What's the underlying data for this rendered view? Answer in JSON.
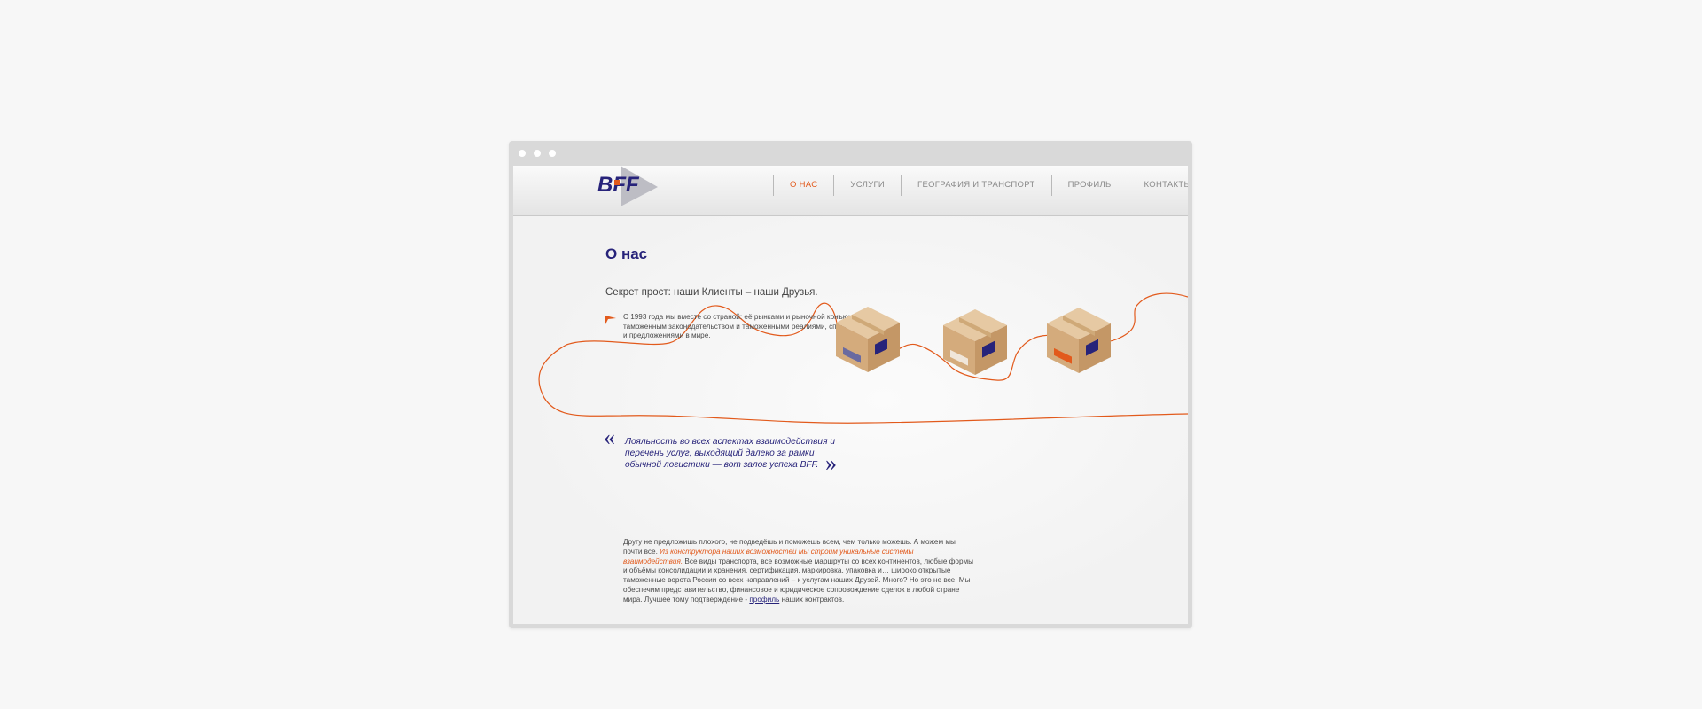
{
  "colors": {
    "accent": "#e25a1c",
    "brand": "#27237a"
  },
  "logo": {
    "text": "BFF"
  },
  "nav": {
    "items": [
      {
        "label": "О НАС",
        "active": true
      },
      {
        "label": "УСЛУГИ"
      },
      {
        "label": "ГЕОГРАФИЯ И ТРАНСПОРТ"
      },
      {
        "label": "ПРОФИЛЬ"
      },
      {
        "label": "КОНТАКТЫ"
      }
    ]
  },
  "main": {
    "title": "О нас",
    "subtitle": "Секрет прост: наши Клиенты – наши Друзья.",
    "bullet_icon": "arrow-flag-icon",
    "bullet": "С 1993 года мы вместе со страной: её рынками и рыночной конъюнктурой, таможенным законодательством и таможенными реалиями, спросом в России и предложениями в мире.",
    "quote": {
      "open": "«",
      "text": "Лояльность во всех аспектах взаимодействия и перечень услуг, выходящий далеко за рамки обычной логистики — вот залог успеха BFF.",
      "close": "»"
    },
    "boxes": [
      "box-icon",
      "box-icon",
      "box-icon"
    ],
    "body": {
      "p1": "Другу не предложишь плохого, не подведёшь и поможешь всем, чем только можешь. А можем мы почти всё.",
      "highlight": "Из конструктора наших возможностей мы строим уникальные системы взаимодействия.",
      "p2": "Все виды транспорта, все возможные маршруты со всех континентов, любые формы и объёмы консолидации и хранения, сертификация, маркировка, упаковка и… широко открытые таможенные ворота России со всех направлений – к услугам наших Друзей. Много? Но это не все! Мы обеспечим представительство, финансовое и юридическое сопровождение сделок в любой стране мира. Лучшее тому подтверждение -",
      "link": "профиль",
      "p3": "наших контрактов."
    }
  }
}
